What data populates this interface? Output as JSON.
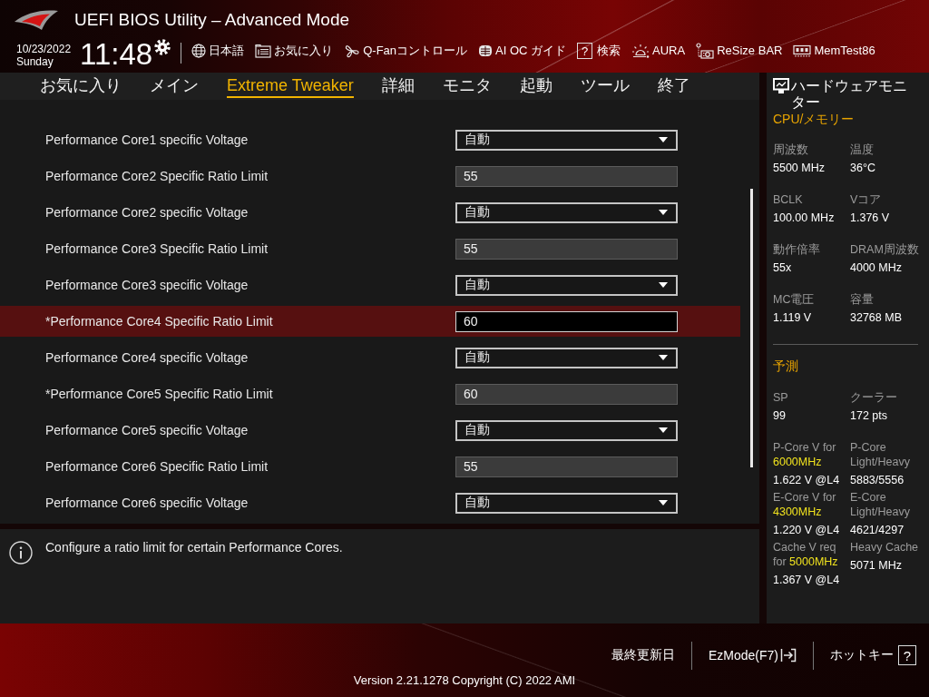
{
  "window": {
    "title": "UEFI BIOS Utility – Advanced Mode"
  },
  "clock": {
    "date": "10/23/2022",
    "weekday": "Sunday",
    "time": "11:48"
  },
  "toolbar": [
    {
      "kind": "language",
      "label": "日本語"
    },
    {
      "kind": "favorites",
      "label": "お気に入り"
    },
    {
      "kind": "fan",
      "label": "Q-Fanコントロール"
    },
    {
      "kind": "ai-oc",
      "label": "AI OC ガイド"
    },
    {
      "kind": "search",
      "icon_text": "?",
      "label": "検索"
    },
    {
      "kind": "aura",
      "label": "AURA"
    },
    {
      "kind": "resize-bar",
      "label": "ReSize BAR"
    },
    {
      "kind": "memtest",
      "label": "MemTest86"
    }
  ],
  "tabs": [
    {
      "label": "お気に入り",
      "selected": false
    },
    {
      "label": "メイン",
      "selected": false
    },
    {
      "label": "Extreme Tweaker",
      "selected": true
    },
    {
      "label": "詳細",
      "selected": false
    },
    {
      "label": "モニタ",
      "selected": false
    },
    {
      "label": "起動",
      "selected": false
    },
    {
      "label": "ツール",
      "selected": false
    },
    {
      "label": "終了",
      "selected": false
    }
  ],
  "settings": [
    {
      "label": "Performance Core1 specific Voltage",
      "kind": "dropdown",
      "value": "自動",
      "selected": false
    },
    {
      "label": "Performance Core2 Specific Ratio Limit",
      "kind": "number",
      "value": "55",
      "selected": false
    },
    {
      "label": "Performance Core2 specific Voltage",
      "kind": "dropdown",
      "value": "自動",
      "selected": false
    },
    {
      "label": "Performance Core3 Specific Ratio Limit",
      "kind": "number",
      "value": "55",
      "selected": false
    },
    {
      "label": "Performance Core3 specific Voltage",
      "kind": "dropdown",
      "value": "自動",
      "selected": false
    },
    {
      "label": "*Performance Core4 Specific Ratio Limit",
      "kind": "number",
      "value": "60",
      "selected": true
    },
    {
      "label": "Performance Core4 specific Voltage",
      "kind": "dropdown",
      "value": "自動",
      "selected": false
    },
    {
      "label": "*Performance Core5 Specific Ratio Limit",
      "kind": "number",
      "value": "60",
      "selected": false
    },
    {
      "label": "Performance Core5 specific Voltage",
      "kind": "dropdown",
      "value": "自動",
      "selected": false
    },
    {
      "label": "Performance Core6 Specific Ratio Limit",
      "kind": "number",
      "value": "55",
      "selected": false
    },
    {
      "label": "Performance Core6 specific Voltage",
      "kind": "dropdown",
      "value": "自動",
      "selected": false
    }
  ],
  "help": {
    "text": "Configure a ratio limit for certain Performance Cores."
  },
  "hardware_monitor": {
    "title": "ハードウェアモニター",
    "sections": [
      {
        "title": "CPU/メモリー",
        "items": [
          {
            "label": "周波数",
            "value": "5500 MHz"
          },
          {
            "label": "温度",
            "value": "36°C"
          },
          {
            "label": "BCLK",
            "value": "100.00 MHz"
          },
          {
            "label": "Vコア",
            "value": "1.376 V"
          },
          {
            "label": "動作倍率",
            "value": "55x"
          },
          {
            "label": "DRAM周波数",
            "value": "4000 MHz"
          },
          {
            "label": "MC電圧",
            "value": "1.119 V"
          },
          {
            "label": "容量",
            "value": "32768 MB"
          }
        ]
      },
      {
        "title": "予測",
        "items": [
          {
            "label": "SP",
            "value": "99"
          },
          {
            "label": "クーラー",
            "value": "172 pts"
          },
          {
            "label": "P-Core V for",
            "highlight": "6000MHz",
            "value": "1.622 V @L4"
          },
          {
            "label": "P-Core Light/Heavy",
            "value": "5883/5556"
          },
          {
            "label": "E-Core V for",
            "highlight": "4300MHz",
            "value": "1.220 V @L4"
          },
          {
            "label": "E-Core Light/Heavy",
            "value": "4621/4297"
          },
          {
            "label": "Cache V req for",
            "highlight": "5000MHz",
            "value": "1.367 V @L4"
          },
          {
            "label": "Heavy Cache",
            "value": "5071 MHz"
          }
        ]
      }
    ]
  },
  "footer": {
    "buttons": [
      {
        "kind": "plain",
        "label": "最終更新日"
      },
      {
        "kind": "exit",
        "label": "EzMode(F7)"
      },
      {
        "kind": "help",
        "label": "ホットキー",
        "icon_text": "?"
      }
    ],
    "version": "Version 2.21.1278 Copyright (C) 2022 AMI"
  }
}
